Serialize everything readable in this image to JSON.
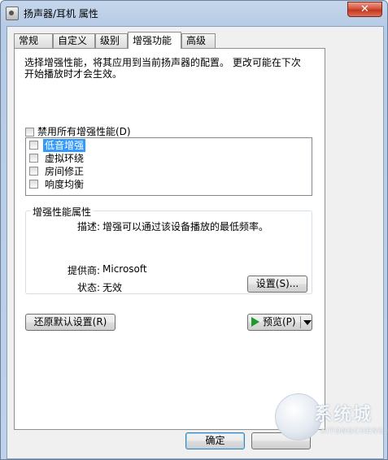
{
  "window": {
    "title": "扬声器/耳机 属性",
    "close_glyph": "✕"
  },
  "tabs": [
    {
      "label": "常规"
    },
    {
      "label": "自定义"
    },
    {
      "label": "级别"
    },
    {
      "label": "增强功能",
      "active": true
    },
    {
      "label": "高级"
    }
  ],
  "enhancements": {
    "description_line1": "选择增强性能，将其应用到当前扬声器的配置。  更改可能在下次",
    "description_line2": "开始播放时才会生效。",
    "disable_all_label": "禁用所有增强性能(D)",
    "items": [
      {
        "label": "低音增强",
        "checked": false,
        "selected": true
      },
      {
        "label": "虚拟环绕",
        "checked": false,
        "selected": false
      },
      {
        "label": "房间修正",
        "checked": false,
        "selected": false
      },
      {
        "label": "响度均衡",
        "checked": false,
        "selected": false
      }
    ]
  },
  "properties": {
    "group_title": "增强性能属性",
    "description_label": "描述:",
    "description_value": "增强可以通过该设备播放的最低频率。",
    "provider_label": "提供商:",
    "provider_value": "Microsoft",
    "status_label": "状态:",
    "status_value": "无效",
    "settings_button": "设置(S)..."
  },
  "buttons": {
    "restore_defaults": "还原默认设置(R)",
    "preview": "预览(P)",
    "ok": "确定"
  },
  "watermark": {
    "brand": "系统城",
    "url": "XITONGCHENG.CC"
  },
  "colors": {
    "selection": "#3399ff",
    "play_icon": "#1e9a2c",
    "close_button": "#c2361d"
  }
}
